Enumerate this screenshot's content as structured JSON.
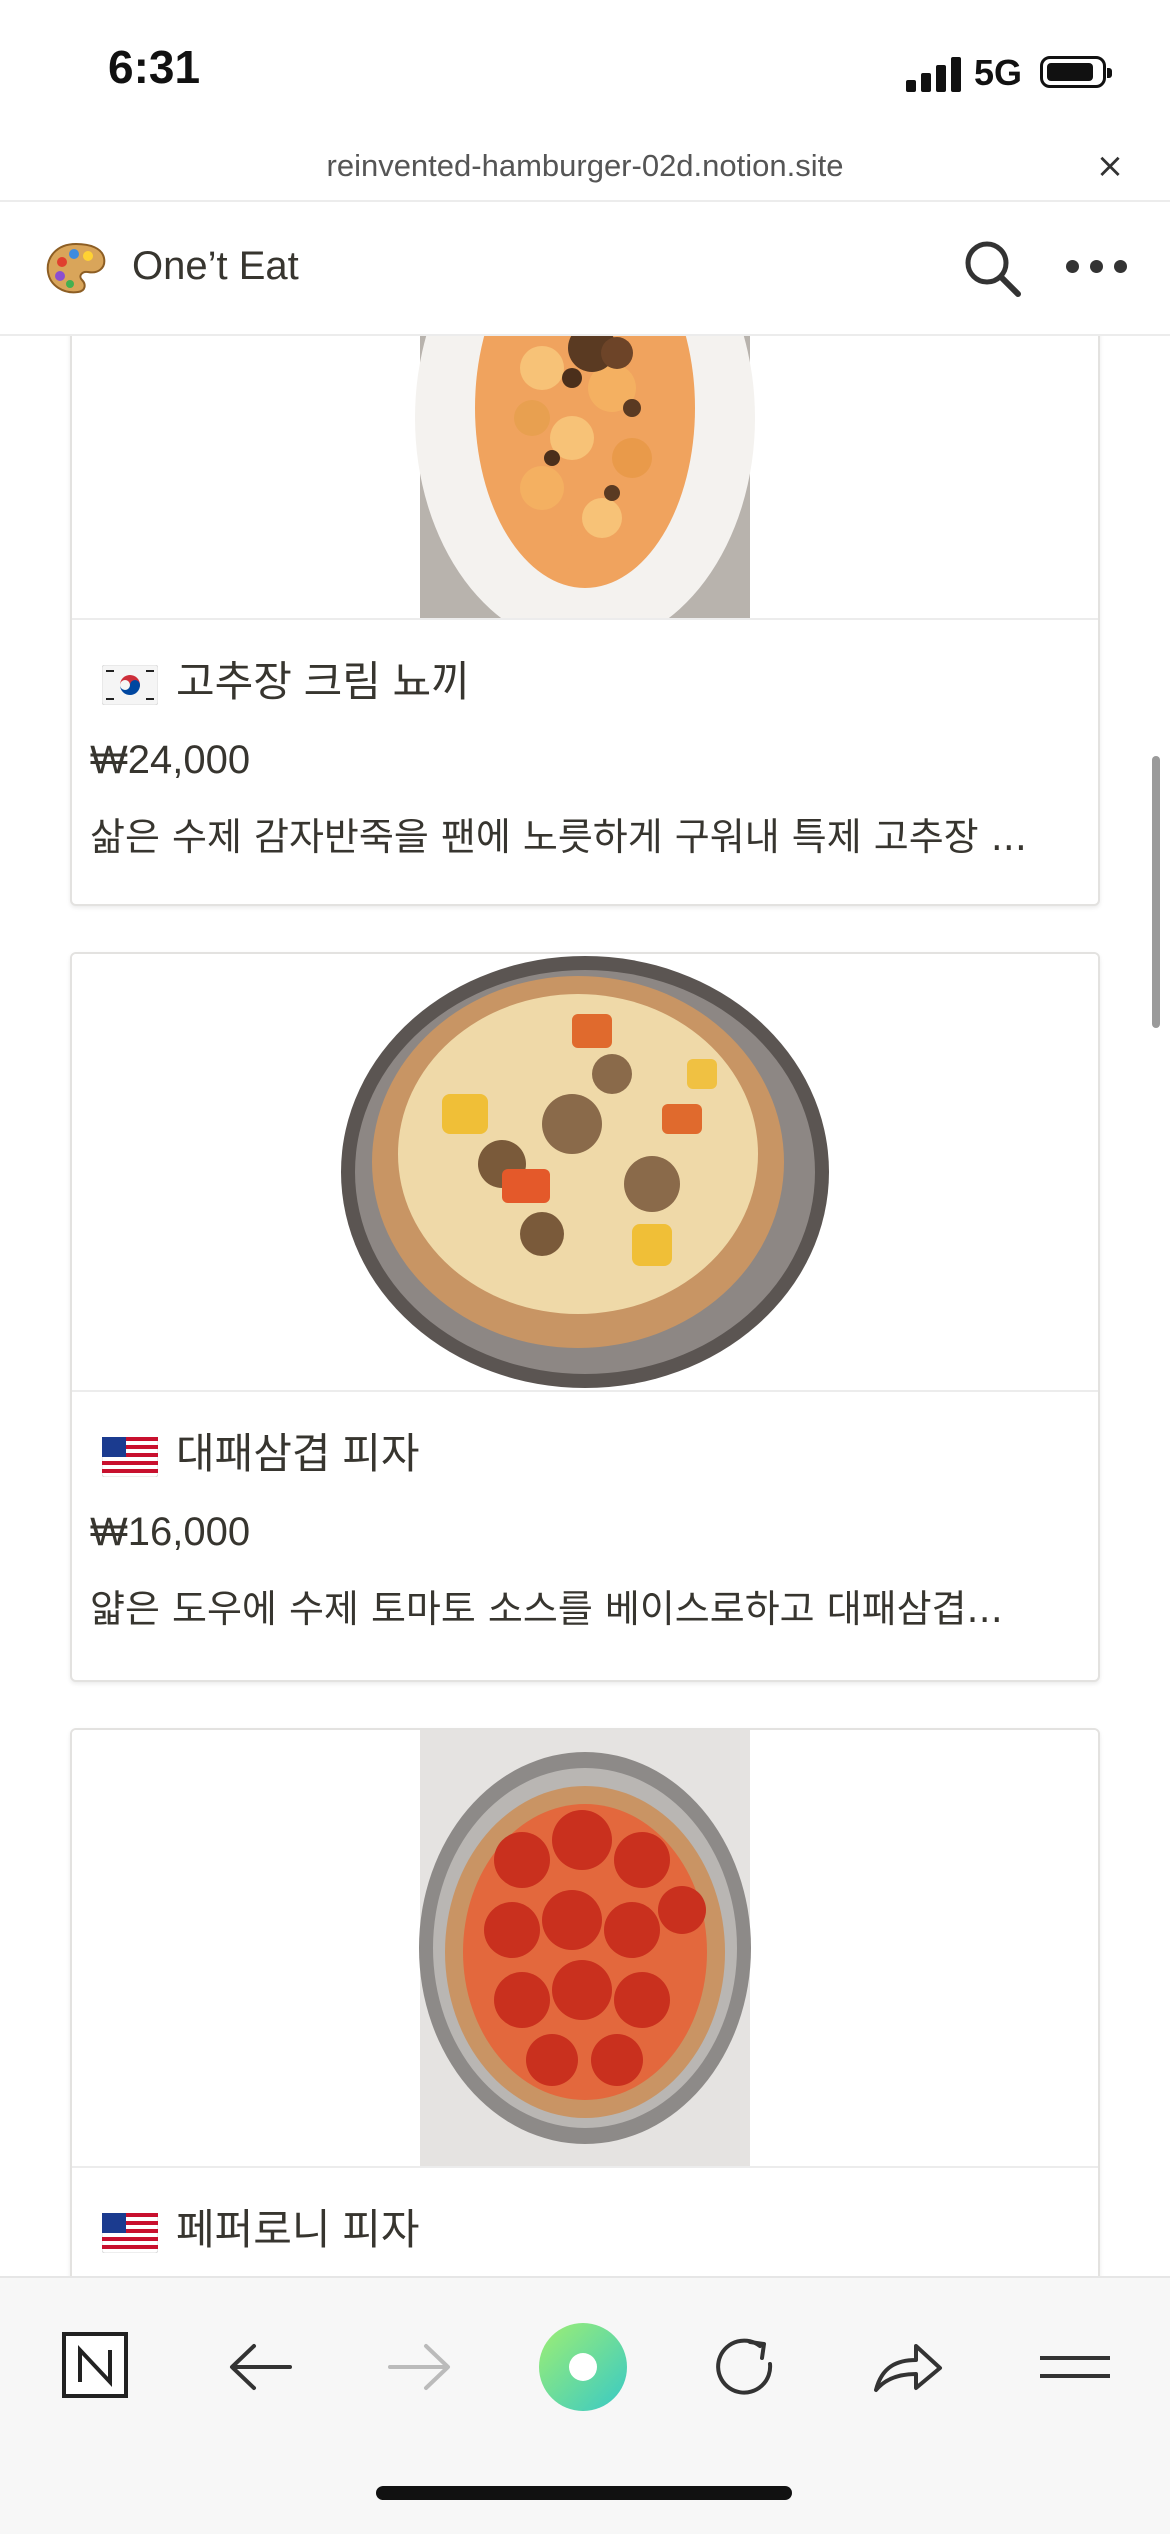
{
  "status_bar": {
    "time": "6:31",
    "network": "5G",
    "icons": [
      "signal-icon",
      "battery-icon"
    ]
  },
  "browser": {
    "url": "reinvented-hamburger-02d.notion.site",
    "close_symbol": "×"
  },
  "header": {
    "icon": "palette-icon",
    "title": "One’t Eat",
    "actions": [
      "search-icon",
      "more-icon"
    ]
  },
  "cards": [
    {
      "flag": "korea-flag-icon",
      "name": "고추장 크림 뇨끼",
      "price": "₩24,000",
      "description": "삶은 수제 감자반죽을 팬에 노릇하게 구워내 특제 고추장 ..."
    },
    {
      "flag": "usa-flag-icon",
      "name": "대패삼겹 피자",
      "price": "₩16,000",
      "description": "얇은 도우에 수제 토마토 소스를 베이스로하고 대패삼겹..."
    },
    {
      "flag": "usa-flag-icon",
      "name": "페퍼로니 피자",
      "price": "",
      "description": ""
    }
  ],
  "toolbar": {
    "items": [
      "notion-icon",
      "back-icon",
      "forward-icon",
      "notion-ai-icon",
      "reload-icon",
      "share-icon",
      "menu-icon"
    ]
  },
  "colors": {
    "text": "#37352f",
    "border": "#e3e2e0",
    "toolbar_bg": "#f7f7f7",
    "ai_gradient": "#5ee3a8"
  }
}
